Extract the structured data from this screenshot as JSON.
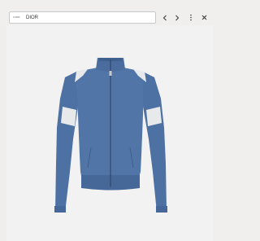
{
  "browser": {
    "address": "DIOR",
    "site_badge": "DIOR",
    "icons": [
      "back-icon",
      "forward-icon",
      "more-options-icon",
      "close-icon"
    ]
  },
  "product": {
    "image": "blue-track-jacket-with-white-sleeve-bands",
    "colors": {
      "body": "#4f72a6",
      "bands": "#e9eaea",
      "background": "#f2f2f2"
    }
  }
}
